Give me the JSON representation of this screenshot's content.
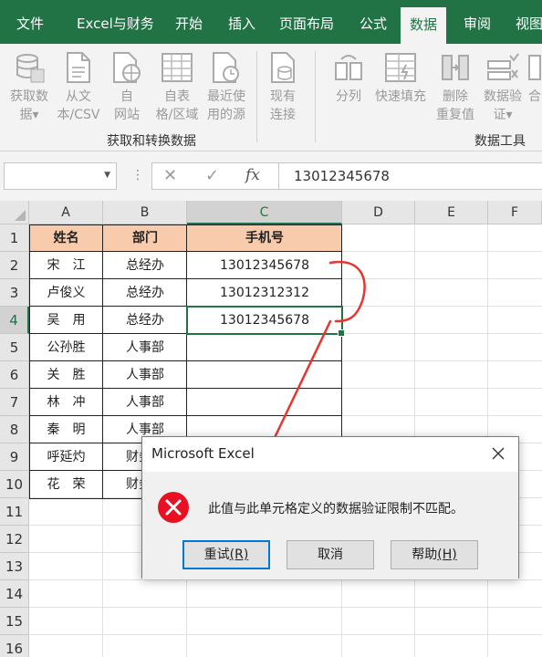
{
  "ribbon_tabs": [
    "文件",
    "Excel与财务",
    "开始",
    "插入",
    "页面布局",
    "公式",
    "数据",
    "审阅",
    "视图"
  ],
  "active_tab": "数据",
  "ribbon": {
    "get_transform": {
      "buttons": [
        {
          "line1": "获取数",
          "line2": "据▾",
          "icon": "database-icon"
        },
        {
          "line1": "从文",
          "line2": "本/CSV",
          "icon": "text-file-icon"
        },
        {
          "line1": "自",
          "line2": "网站",
          "icon": "web-icon"
        },
        {
          "line1": "自表",
          "line2": "格/区域",
          "icon": "table-icon"
        },
        {
          "line1": "最近使",
          "line2": "用的源",
          "icon": "recent-source-icon"
        }
      ],
      "label": "获取和转换数据"
    },
    "connections": {
      "buttons": [
        {
          "line1": "现有",
          "line2": "连接",
          "icon": "existing-connections-icon"
        }
      ]
    },
    "data_tools": {
      "buttons": [
        {
          "line1": "分列",
          "line2": "",
          "icon": "text-to-columns-icon"
        },
        {
          "line1": "快速填充",
          "line2": "",
          "icon": "flash-fill-icon"
        },
        {
          "line1": "删除",
          "line2": "重复值",
          "icon": "remove-duplicates-icon"
        },
        {
          "line1": "数据验",
          "line2": "证▾",
          "icon": "data-validation-icon"
        },
        {
          "line1": "合",
          "line2": "",
          "icon": "consolidate-icon"
        }
      ],
      "label": "数据工具"
    }
  },
  "formula_bar": {
    "name_box": "",
    "cancel": "✕",
    "enter": "✓",
    "fx": "fx",
    "content": "13012345678"
  },
  "sheet": {
    "columns": [
      "A",
      "B",
      "C",
      "D",
      "E",
      "F"
    ],
    "rows": [
      "1",
      "2",
      "3",
      "4",
      "5",
      "6",
      "7",
      "8",
      "9",
      "10",
      "11",
      "12",
      "13",
      "14",
      "15",
      "16"
    ],
    "header_row": [
      "姓名",
      "部门",
      "手机号"
    ],
    "data_rows": [
      [
        "宋　江",
        "总经办",
        "13012345678"
      ],
      [
        "卢俊义",
        "总经办",
        "13012312312"
      ],
      [
        "吴　用",
        "总经办",
        "13012345678"
      ],
      [
        "公孙胜",
        "人事部",
        ""
      ],
      [
        "关　胜",
        "人事部",
        ""
      ],
      [
        "林　冲",
        "人事部",
        ""
      ],
      [
        "秦　明",
        "人事部",
        ""
      ],
      [
        "呼延灼",
        "财务部",
        ""
      ],
      [
        "花　荣",
        "财务部",
        ""
      ]
    ],
    "header_fill": "#f8cbad"
  },
  "dialog": {
    "title": "Microsoft Excel",
    "message": "此值与此单元格定义的数据验证限制不匹配。",
    "buttons": [
      {
        "label": "重试",
        "key": "(R)"
      },
      {
        "label": "取消",
        "key": ""
      },
      {
        "label": "帮助",
        "key": "(H)"
      }
    ],
    "icon": "error-icon",
    "icon_color": "#e81123"
  },
  "colors": {
    "brand": "#217346",
    "annotation": "#e8342e"
  }
}
